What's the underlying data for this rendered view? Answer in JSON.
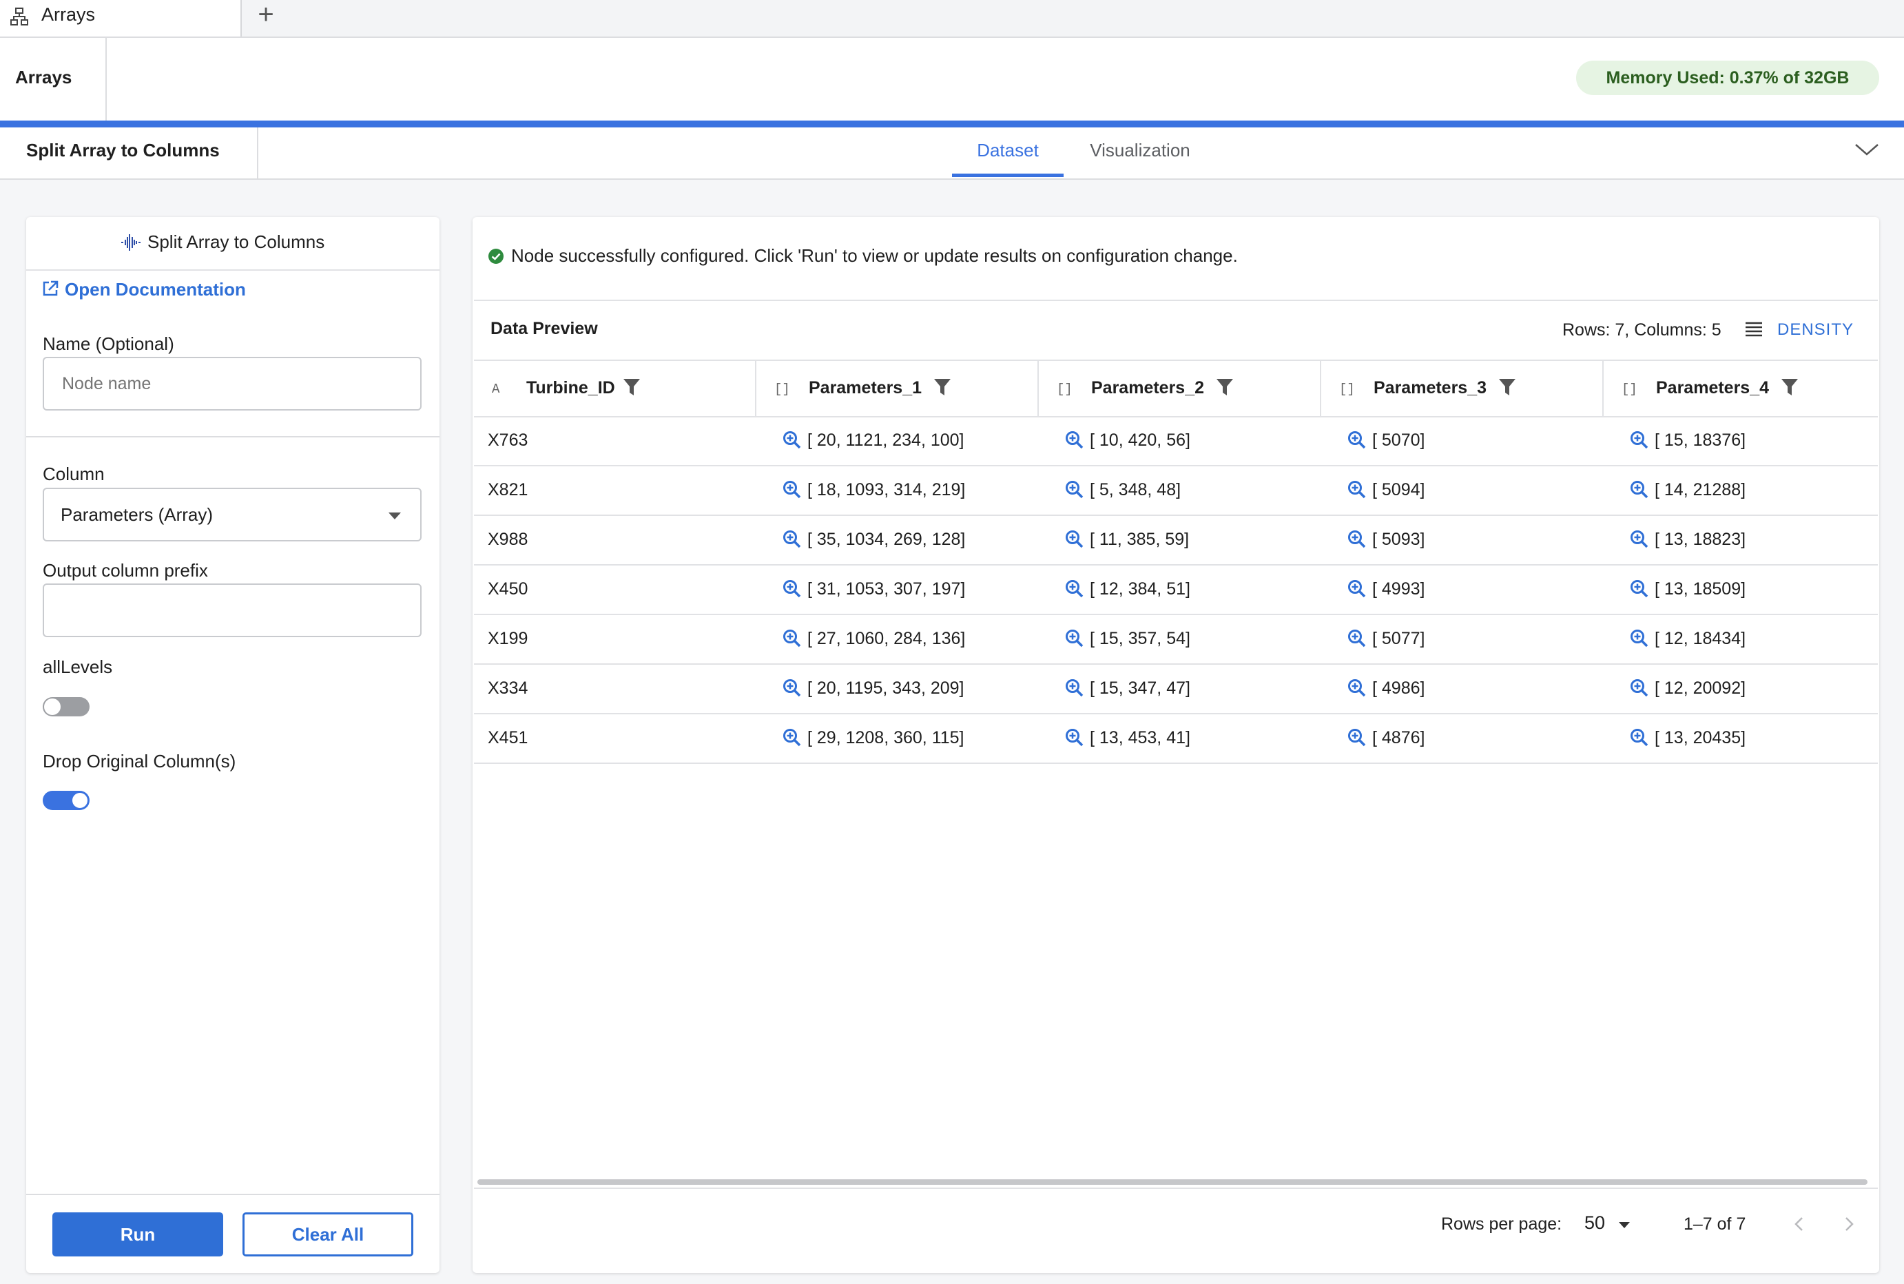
{
  "tabs": [
    {
      "label": "Arrays",
      "icon": "hierarchy-icon"
    }
  ],
  "add_tab_symbol": "+",
  "header": {
    "title": "Arrays",
    "memory": "Memory Used: 0.37% of 32GB"
  },
  "subheader": {
    "title": "Split Array to Columns",
    "tabs": [
      {
        "label": "Dataset",
        "active": true
      },
      {
        "label": "Visualization",
        "active": false
      }
    ]
  },
  "config": {
    "title": "Split Array to Columns",
    "doc_link": "Open Documentation",
    "name_label": "Name (Optional)",
    "name_placeholder": "Node name",
    "column_label": "Column",
    "column_value": "Parameters (Array)",
    "prefix_label": "Output column prefix",
    "prefix_value": "",
    "alllevels_label": "allLevels",
    "alllevels_on": false,
    "drop_label": "Drop Original Column(s)",
    "drop_on": true,
    "run_label": "Run",
    "clear_label": "Clear All"
  },
  "status": "Node successfully configured. Click 'Run' to view or update results on configuration change.",
  "preview": {
    "title": "Data Preview",
    "rows_info": "Rows: 7, Columns: 5",
    "density_label": "DENSITY",
    "columns": [
      {
        "type": "A",
        "name": "Turbine_ID"
      },
      {
        "type": "[]",
        "name": "Parameters_1"
      },
      {
        "type": "[]",
        "name": "Parameters_2"
      },
      {
        "type": "[]",
        "name": "Parameters_3"
      },
      {
        "type": "[]",
        "name": "Parameters_4"
      }
    ],
    "rows": [
      [
        "X763",
        "[ 20, 1121, 234, 100]",
        "[ 10, 420, 56]",
        "[ 5070]",
        "[ 15, 18376]"
      ],
      [
        "X821",
        "[ 18, 1093, 314, 219]",
        "[ 5, 348, 48]",
        "[ 5094]",
        "[ 14, 21288]"
      ],
      [
        "X988",
        "[ 35, 1034, 269, 128]",
        "[ 11, 385, 59]",
        "[ 5093]",
        "[ 13, 18823]"
      ],
      [
        "X450",
        "[ 31, 1053, 307, 197]",
        "[ 12, 384, 51]",
        "[ 4993]",
        "[ 13, 18509]"
      ],
      [
        "X199",
        "[ 27, 1060, 284, 136]",
        "[ 15, 357, 54]",
        "[ 5077]",
        "[ 12, 18434]"
      ],
      [
        "X334",
        "[ 20, 1195, 343, 209]",
        "[ 15, 347, 47]",
        "[ 4986]",
        "[ 12, 20092]"
      ],
      [
        "X451",
        "[ 29, 1208, 360, 115]",
        "[ 13, 453, 41]",
        "[ 4876]",
        "[ 13, 20435]"
      ]
    ],
    "footer": {
      "rows_per_page_label": "Rows per page:",
      "rows_per_page": "50",
      "range": "1–7 of 7"
    }
  },
  "colors": {
    "accent": "#3a72e0",
    "link": "#2f6fd6",
    "success": "#2e8b3e",
    "memory_bg": "#e6f4e3"
  }
}
